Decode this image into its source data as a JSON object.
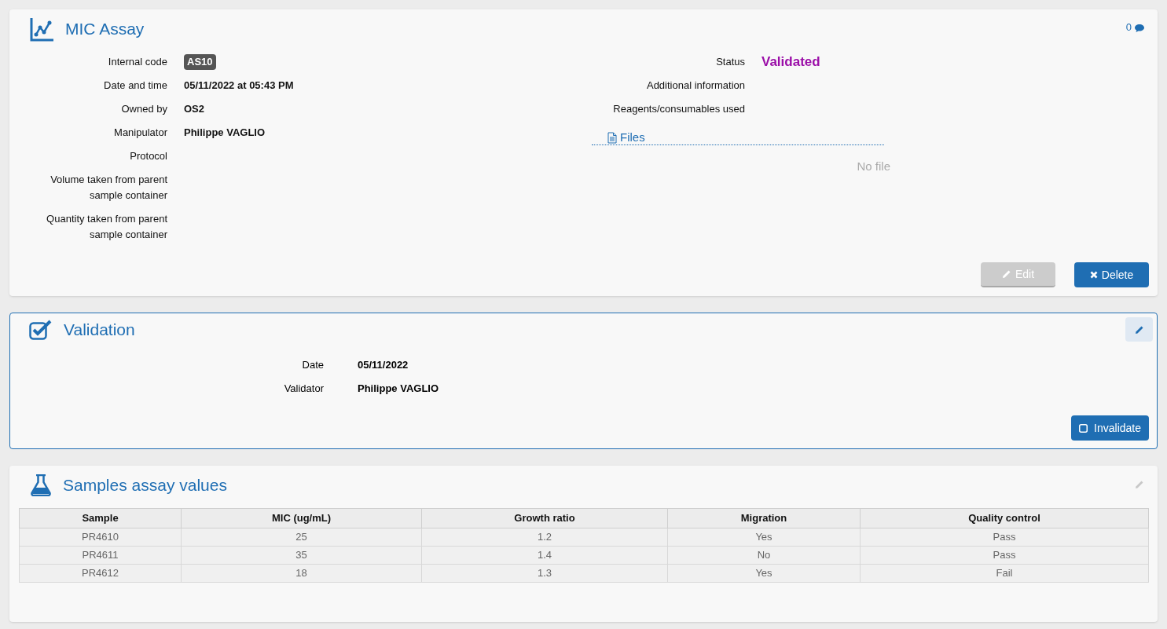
{
  "assay": {
    "title": "MIC Assay",
    "comment_count": "0",
    "left_fields": [
      {
        "label": "Internal code",
        "value": "AS10",
        "kind": "badge"
      },
      {
        "label": "Date and time",
        "value": "05/11/2022 at 05:43 PM",
        "kind": "text"
      },
      {
        "label": "Owned by",
        "value": "OS2",
        "kind": "text"
      },
      {
        "label": "Manipulator",
        "value": "Philippe VAGLIO",
        "kind": "text"
      },
      {
        "label": "Protocol"
      },
      {
        "label": "Volume taken from parent sample container"
      },
      {
        "label": "Quantity taken from parent sample container"
      }
    ],
    "right_fields": [
      {
        "label": "Status",
        "value": "Validated",
        "kind": "status"
      },
      {
        "label": "Additional information"
      },
      {
        "label": "Reagents/consumables used"
      }
    ],
    "files": {
      "title": "Files",
      "empty": "No file"
    },
    "buttons": [
      {
        "label": "Edit",
        "kind": "edit",
        "disabled": true
      },
      {
        "label": "Delete",
        "kind": "delete",
        "disabled": false
      }
    ]
  },
  "validation": {
    "title": "Validation",
    "fields": [
      {
        "label": "Date",
        "value": "05/11/2022"
      },
      {
        "label": "Validator",
        "value": "Philippe VAGLIO"
      }
    ],
    "button": {
      "label": "Invalidate"
    }
  },
  "samples": {
    "title": "Samples assay values",
    "table": {
      "columns": [
        "Sample",
        "MIC (ug/mL)",
        "Growth ratio",
        "Migration",
        "Quality control"
      ],
      "rows": [
        [
          "PR4610",
          "25",
          "1.2",
          "Yes",
          "Pass"
        ],
        [
          "PR4611",
          "35",
          "1.4",
          "No",
          "Pass"
        ],
        [
          "PR4612",
          "18",
          "1.3",
          "Yes",
          "Fail"
        ]
      ]
    }
  }
}
